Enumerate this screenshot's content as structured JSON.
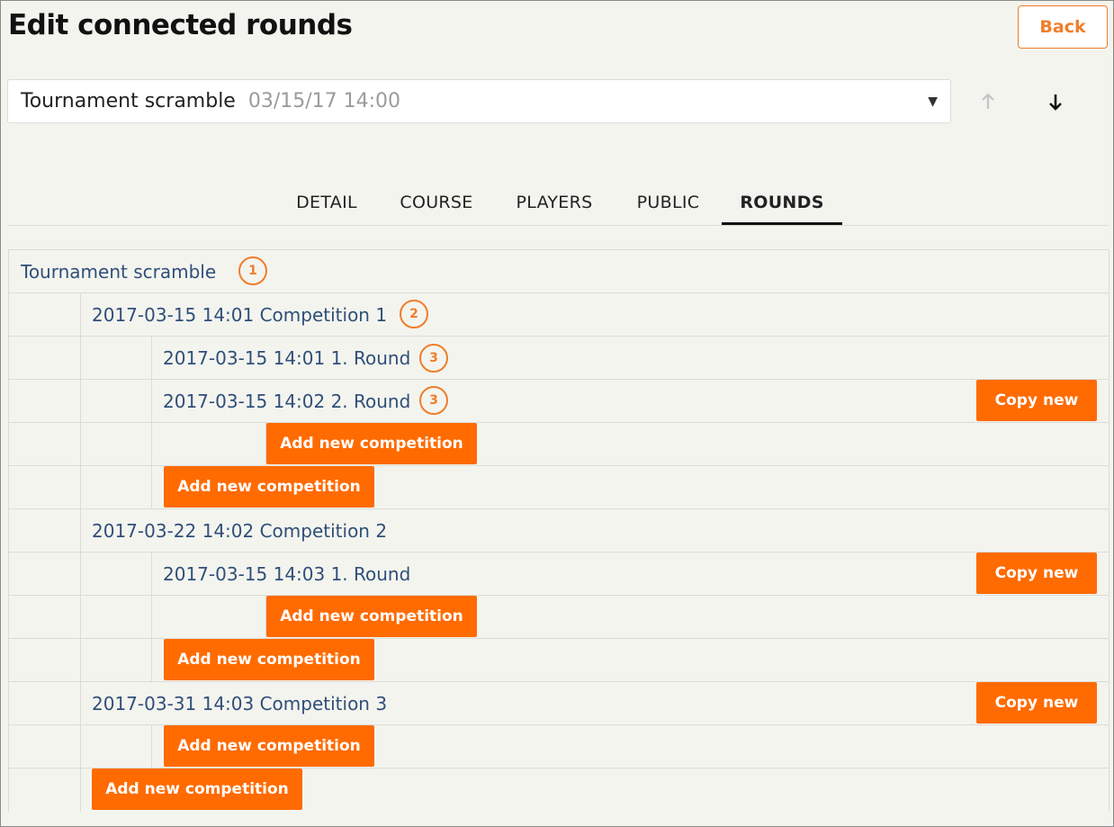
{
  "page": {
    "title": "Edit connected rounds",
    "back_label": "Back"
  },
  "selector": {
    "name": "Tournament scramble",
    "date": "03/15/17 14:00",
    "caret_icon": "caret-down-icon",
    "up_icon": "arrow-up-icon",
    "down_icon": "arrow-down-icon"
  },
  "tabs": [
    {
      "label": "DETAIL",
      "active": false
    },
    {
      "label": "COURSE",
      "active": false
    },
    {
      "label": "PLAYERS",
      "active": false
    },
    {
      "label": "PUBLIC",
      "active": false
    },
    {
      "label": "ROUNDS",
      "active": true
    }
  ],
  "tree": {
    "root": {
      "label": "Tournament scramble",
      "badge": "1"
    },
    "competitions": [
      {
        "label": "2017-03-15 14:01 Competition 1",
        "badge": "2",
        "rounds": [
          {
            "label": "2017-03-15 14:01 1. Round",
            "badge": "3"
          },
          {
            "label": "2017-03-15 14:02 2. Round",
            "badge": "3",
            "copy": "Copy new"
          }
        ]
      },
      {
        "label": "2017-03-22 14:02 Competition 2",
        "rounds": [
          {
            "label": "2017-03-15 14:03 1. Round",
            "copy": "Copy new"
          }
        ]
      },
      {
        "label": "2017-03-31 14:03 Competition 3",
        "copy": "Copy new"
      }
    ],
    "add_label": "Add new competition",
    "copy_label": "Copy new"
  },
  "colors": {
    "accent": "#ff6b00",
    "badge": "#f07d2a",
    "link": "#2f4f79",
    "background": "#f4f4ef"
  }
}
